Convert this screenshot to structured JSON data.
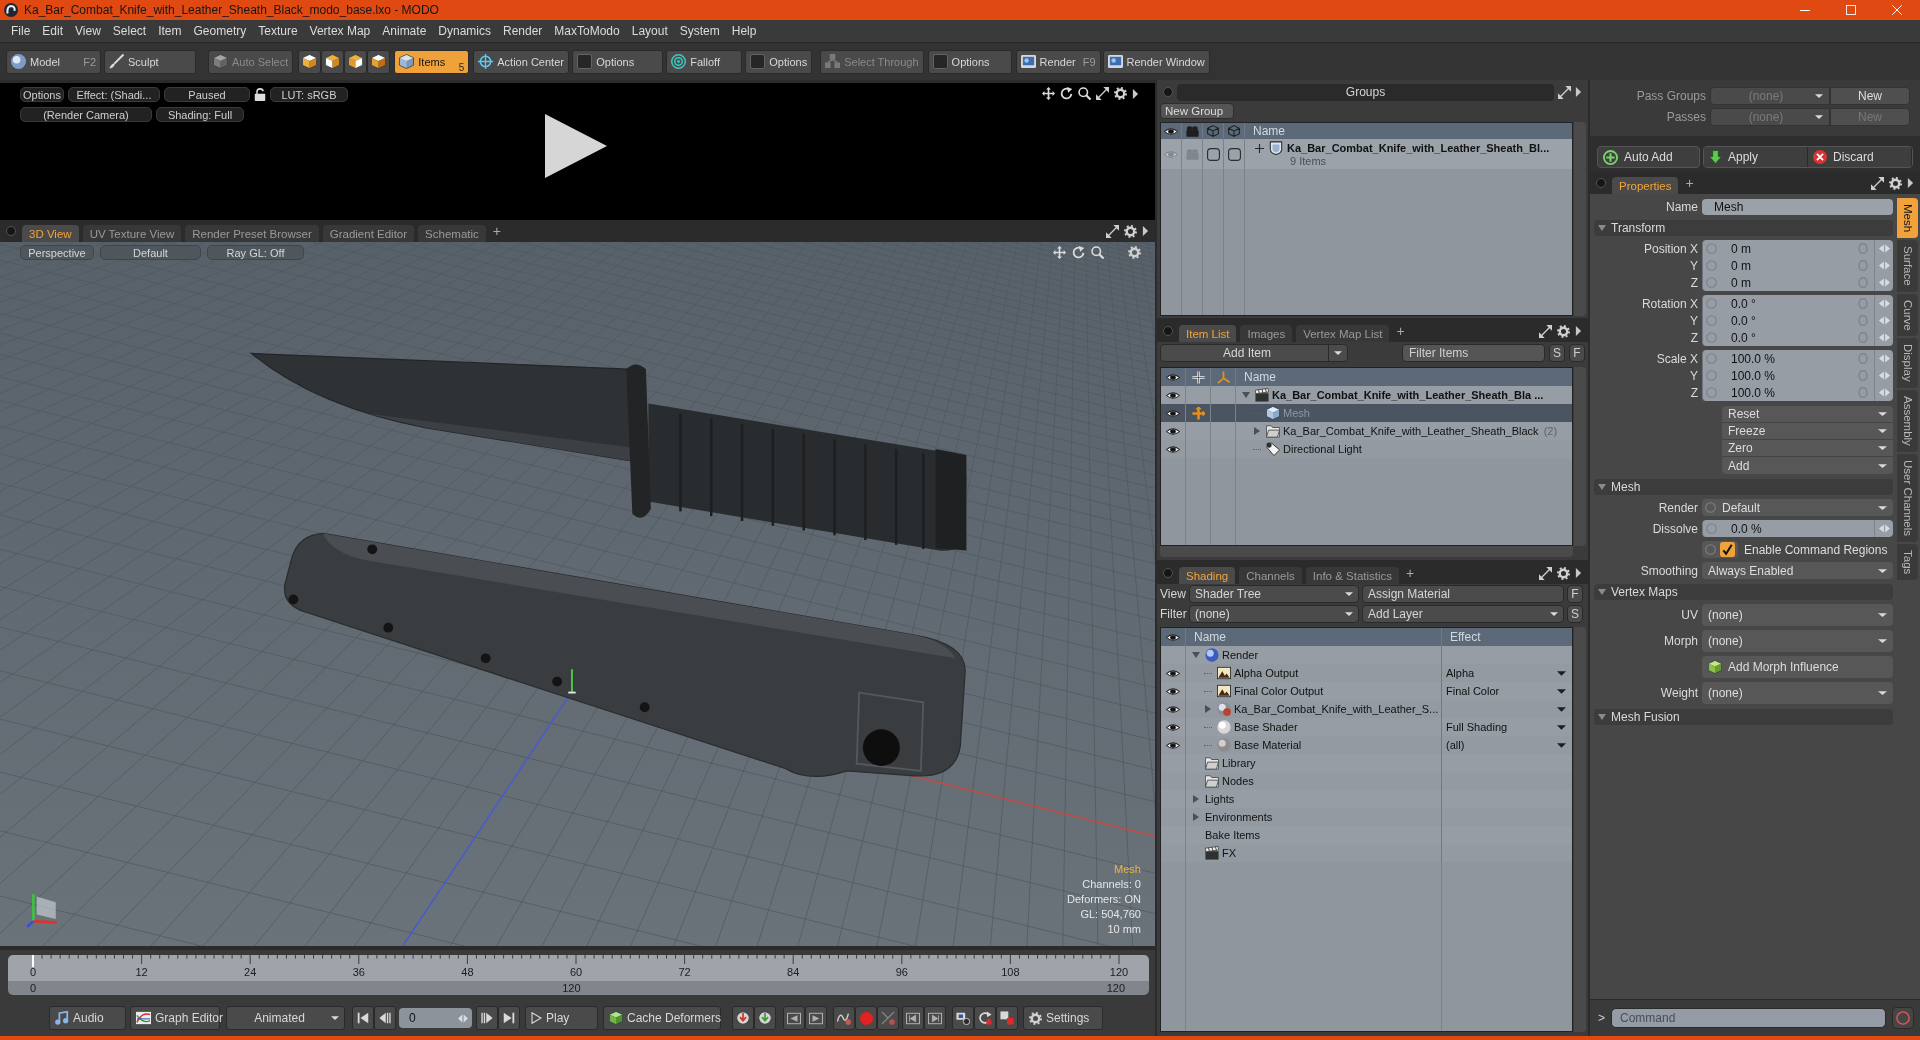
{
  "window": {
    "title": "Ka_Bar_Combat_Knife_with_Leather_Sheath_Black_modo_base.lxo - MODO"
  },
  "menu_bar": [
    "File",
    "Edit",
    "View",
    "Select",
    "Item",
    "Geometry",
    "Texture",
    "Vertex Map",
    "Animate",
    "Dynamics",
    "Render",
    "MaxToModo",
    "Layout",
    "System",
    "Help"
  ],
  "toolbar": [
    {
      "label": "Model",
      "shortcut": "F2",
      "selected": false,
      "disabled": false
    },
    {
      "label": "Sculpt",
      "selected": false,
      "disabled": false
    },
    {
      "label": "Auto Select",
      "selected": false,
      "disabled": true
    },
    {
      "label": "Items",
      "shortcut": "5",
      "selected": true,
      "disabled": false
    },
    {
      "label": "Action Center",
      "selected": false,
      "disabled": false
    },
    {
      "label": "Options",
      "selected": false,
      "disabled": false
    },
    {
      "label": "Falloff",
      "selected": false,
      "disabled": false
    },
    {
      "label": "Options",
      "selected": false,
      "disabled": false
    },
    {
      "label": "Select Through",
      "selected": false,
      "disabled": true
    },
    {
      "label": "Options",
      "selected": false,
      "disabled": false
    },
    {
      "label": "Render",
      "shortcut": "F9",
      "selected": false,
      "disabled": false
    },
    {
      "label": "Render Window",
      "selected": false,
      "disabled": false
    }
  ],
  "render_preview": {
    "options": "Options",
    "effect": "Effect: (Shadi...",
    "status": "Paused",
    "lut": "LUT: sRGB",
    "camera": "(Render Camera)",
    "shading": "Shading: Full"
  },
  "viewport": {
    "tabs": [
      {
        "label": "3D View",
        "selected": true
      },
      {
        "label": "UV Texture View",
        "selected": false
      },
      {
        "label": "Render Preset Browser",
        "selected": false
      },
      {
        "label": "Gradient Editor",
        "selected": false
      },
      {
        "label": "Schematic",
        "selected": false
      }
    ],
    "add_tab": "+",
    "view_buttons": [
      "Perspective",
      "Default",
      "Ray GL: Off"
    ],
    "info": {
      "selection": "Mesh",
      "lines": [
        "Channels: 0",
        "Deformers: ON",
        "GL: 504,760",
        "10 mm"
      ]
    }
  },
  "timeline": {
    "ticks": [
      "0",
      "12",
      "24",
      "36",
      "48",
      "60",
      "72",
      "84",
      "96",
      "108",
      "120"
    ],
    "range_start": "0",
    "range_mid": "120",
    "range_end": "120",
    "playhead": {
      "level": 0
    }
  },
  "transport": {
    "audio": "Audio",
    "graph_editor": "Graph Editor",
    "mode": "Animated",
    "frame": "0",
    "play": "Play",
    "cache": "Cache Deformers",
    "settings": "Settings"
  },
  "groups": {
    "title": "Groups",
    "new_group": "New Group",
    "column": "Name",
    "rows": [
      {
        "name": "Ka_Bar_Combat_Knife_with_Leather_Sheath_Bl...",
        "count": "9 Items",
        "expanded": false
      }
    ]
  },
  "item_list": {
    "tabs": [
      {
        "label": "Item List",
        "selected": true
      },
      {
        "label": "Images",
        "selected": false
      },
      {
        "label": "Vertex Map List",
        "selected": false
      }
    ],
    "add_tab": "+",
    "add_item": "Add Item",
    "filter": {
      "placeholder": "Filter Items"
    },
    "filter_buttons": [
      "S",
      "F"
    ],
    "column": "Name",
    "items": [
      {
        "kind": "scene",
        "name": "Ka_Bar_Combat_Knife_with_Leather_Sheath_Bla ...",
        "expanded": true,
        "selected": false,
        "visible": true,
        "children": [
          {
            "kind": "mesh",
            "name": "Mesh",
            "selected": true,
            "visible": true
          },
          {
            "kind": "group",
            "name": "Ka_Bar_Combat_Knife_with_Leather_Sheath_Black",
            "count": "(2)",
            "expanded": false,
            "selected": false,
            "visible": true
          },
          {
            "kind": "light",
            "name": "Directional Light",
            "selected": false,
            "visible": true
          }
        ]
      }
    ]
  },
  "shading": {
    "tabs": [
      {
        "label": "Shading",
        "selected": true
      },
      {
        "label": "Channels",
        "selected": false
      },
      {
        "label": "Info & Statistics",
        "selected": false
      }
    ],
    "add_tab": "+",
    "view": {
      "label": "View",
      "value": "Shader Tree"
    },
    "assign": "Assign Material",
    "assign_key": "F",
    "filter": {
      "label": "Filter",
      "value": "(none)"
    },
    "add_layer": "Add Layer",
    "layer_key": "S",
    "columns": [
      "Name",
      "Effect"
    ],
    "layers": [
      {
        "kind": "render",
        "name": "Render",
        "expanded": true,
        "visible": false,
        "children": [
          {
            "kind": "output",
            "name": "Alpha Output",
            "effect": "Alpha",
            "visible": true
          },
          {
            "kind": "output",
            "name": "Final Color Output",
            "effect": "Final Color",
            "visible": true
          },
          {
            "kind": "material-group",
            "name": "Ka_Bar_Combat_Knife_with_Leather_S...",
            "expanded": false,
            "visible": true
          },
          {
            "kind": "shader",
            "name": "Base Shader",
            "effect": "Full Shading",
            "visible": true
          },
          {
            "kind": "material",
            "name": "Base Material",
            "effect": "(all)",
            "visible": true
          }
        ]
      },
      {
        "kind": "folder",
        "name": "Library",
        "visible": false
      },
      {
        "kind": "folder",
        "name": "Nodes",
        "visible": false
      },
      {
        "kind": "plain",
        "name": "Lights",
        "expanded": false,
        "visible": false
      },
      {
        "kind": "plain",
        "name": "Environments",
        "expanded": false,
        "visible": false
      },
      {
        "kind": "plain",
        "name": "Bake Items",
        "visible": false
      },
      {
        "kind": "scene",
        "name": "FX",
        "visible": false
      }
    ]
  },
  "passes": [
    {
      "label": "Pass Groups",
      "value": "(none)",
      "button": "New",
      "disabled": false
    },
    {
      "label": "Passes",
      "value": "(none)",
      "button": "New",
      "disabled": true
    }
  ],
  "actions": [
    "Auto Add",
    "Apply",
    "Discard"
  ],
  "properties": {
    "tabs": [
      {
        "label": "Properties",
        "selected": true
      }
    ],
    "add_tab": "+",
    "name_label": "Name",
    "name": "Mesh",
    "sections": [
      {
        "title": "Transform",
        "expanded": true,
        "rows": [
          {
            "kind": "vector",
            "labels": [
              "Position X",
              "Y",
              "Z"
            ],
            "values": [
              "0 m",
              "0 m",
              "0 m"
            ]
          },
          {
            "kind": "vector",
            "labels": [
              "Rotation X",
              "Y",
              "Z"
            ],
            "values": [
              "0.0 °",
              "0.0 °",
              "0.0 °"
            ]
          },
          {
            "kind": "vector",
            "labels": [
              "Scale X",
              "Y",
              "Z"
            ],
            "values": [
              "100.0 %",
              "100.0 %",
              "100.0 %"
            ]
          },
          {
            "kind": "menus",
            "items": [
              "Reset",
              "Freeze",
              "Zero",
              "Add"
            ]
          }
        ]
      },
      {
        "title": "Mesh",
        "expanded": true,
        "rows": [
          {
            "kind": "dropdown",
            "label": "Render",
            "value": "Default",
            "keyable": true
          },
          {
            "kind": "number",
            "label": "Dissolve",
            "value": "0.0 %"
          },
          {
            "kind": "checkbox",
            "label": "Enable Command Regions",
            "checked": true
          },
          {
            "kind": "dropdown",
            "label": "Smoothing",
            "value": "Always Enabled",
            "keyable": false
          }
        ]
      },
      {
        "title": "Vertex Maps",
        "expanded": true,
        "rows": [
          {
            "kind": "dropdown",
            "label": "UV",
            "value": "(none)",
            "keyable": false
          },
          {
            "kind": "dropdown",
            "label": "Morph",
            "value": "(none)",
            "keyable": false
          },
          {
            "kind": "button",
            "label": "Add Morph Influence"
          },
          {
            "kind": "dropdown",
            "label": "Weight",
            "value": "(none)",
            "keyable": false
          }
        ]
      },
      {
        "title": "Mesh Fusion",
        "expanded": true
      }
    ],
    "side_tabs": [
      {
        "label": "Mesh",
        "selected": true
      },
      {
        "label": "Surface",
        "selected": false
      },
      {
        "label": "Curve",
        "selected": false
      },
      {
        "label": "Display",
        "selected": false
      },
      {
        "label": "Assembly",
        "selected": false
      },
      {
        "label": "User Channels",
        "selected": false
      },
      {
        "label": "Tags",
        "selected": false
      }
    ]
  },
  "command": {
    "prompt": ">",
    "placeholder": "Command"
  }
}
